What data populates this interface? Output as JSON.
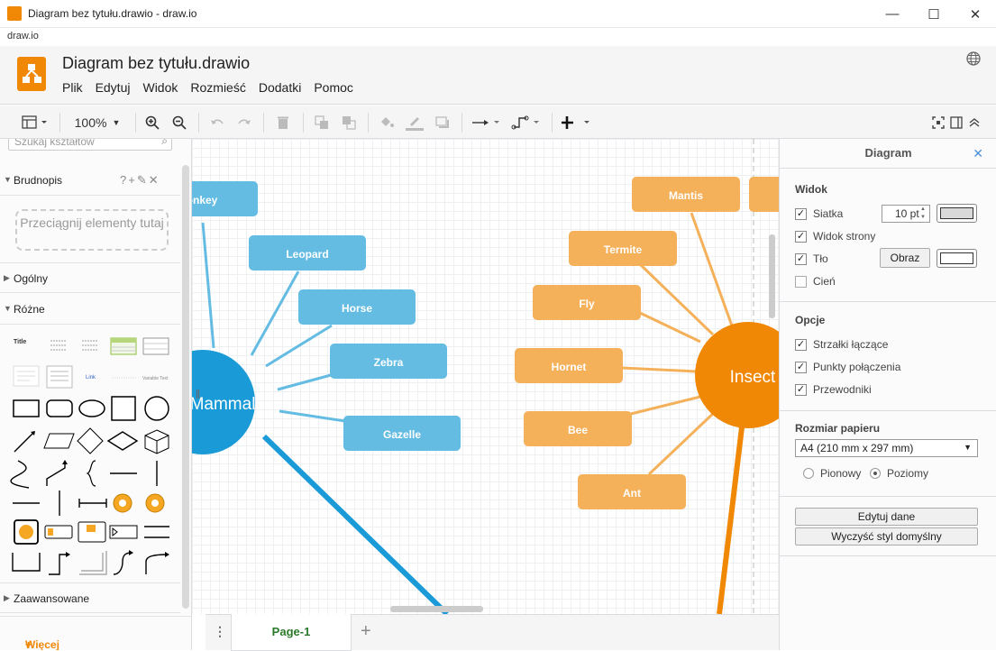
{
  "window": {
    "title": "Diagram bez tytułu.drawio - draw.io",
    "url": "draw.io",
    "controls": {
      "minimize": "—",
      "maximize": "☐",
      "close": "✕"
    }
  },
  "header": {
    "doc_title": "Diagram bez tytułu.drawio",
    "menu": [
      "Plik",
      "Edytuj",
      "Widok",
      "Rozmieść",
      "Dodatki",
      "Pomoc"
    ]
  },
  "toolbar": {
    "zoom": "100%",
    "icons": [
      "format-panel-icon",
      "zoom-in-icon",
      "zoom-out-icon",
      "undo-icon",
      "redo-icon",
      "delete-icon",
      "to-front-icon",
      "to-back-icon",
      "fill-color-icon",
      "line-color-icon",
      "shadow-icon",
      "connection-icon",
      "waypoints-icon",
      "insert-icon",
      "fullscreen-icon",
      "toggle-panel-icon",
      "collapse-icon"
    ]
  },
  "sidebar": {
    "search_placeholder": "Szukaj kształtów",
    "scratchpad_title": "Brudnopis",
    "scratchpad_drop": "Przeciągnij elementy tutaj",
    "sections": [
      "Ogólny",
      "Różne",
      "Zaawansowane"
    ],
    "shape_labels": {
      "title": "Title",
      "link": "Link",
      "variable_text": "Variable Text"
    },
    "more_shapes": "Więcej kształtów..."
  },
  "canvas": {
    "left_center": "Mammal",
    "right_center": "Insect",
    "mammal_nodes": [
      "Monkey",
      "Leopard",
      "Horse",
      "Zebra",
      "Gazelle"
    ],
    "insect_nodes": [
      "Mantis",
      "Termite",
      "Fly",
      "Hornet",
      "Bee",
      "Ant"
    ],
    "colors": {
      "mammal": "#1a9bd7",
      "mammal_node": "#64bce3",
      "insect": "#f08705",
      "insect_node": "#f5b05a"
    }
  },
  "pages": {
    "current": "Page-1",
    "add": "+"
  },
  "format_panel": {
    "title": "Diagram",
    "view_section": "Widok",
    "grid_label": "Siatka",
    "grid_size": "10 pt",
    "page_view_label": "Widok strony",
    "background_label": "Tło",
    "image_button": "Obraz",
    "shadow_label": "Cień",
    "options_section": "Opcje",
    "connection_arrows": "Strzałki łączące",
    "connection_points": "Punkty połączenia",
    "guides": "Przewodniki",
    "paper_size_section": "Rozmiar papieru",
    "paper_size_value": "A4 (210 mm x 297 mm)",
    "portrait": "Pionowy",
    "landscape": "Poziomy",
    "edit_data": "Edytuj dane",
    "clear_style": "Wyczyść styl domyślny",
    "checked": {
      "grid": true,
      "page_view": true,
      "background": true,
      "shadow": false,
      "arrows": true,
      "points": true,
      "guides": true
    },
    "orientation": "landscape"
  }
}
